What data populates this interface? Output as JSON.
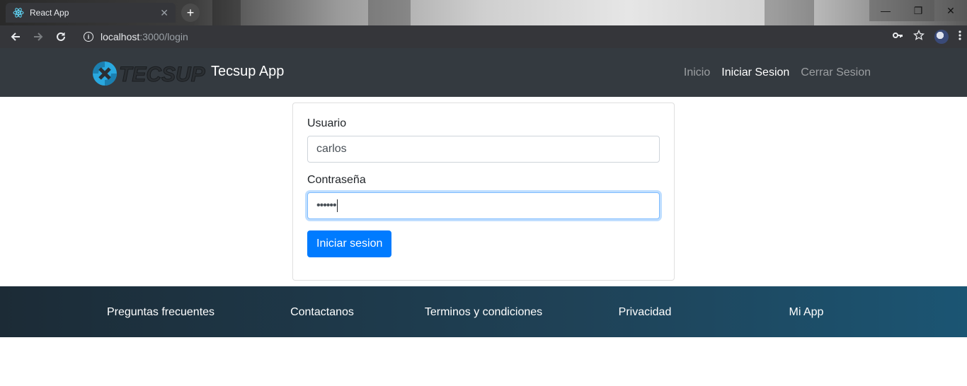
{
  "browser": {
    "tab_title": "React App",
    "tab_close": "✕",
    "new_tab": "+",
    "address_host": "localhost",
    "address_path": ":3000/login",
    "window_minimize": "—",
    "window_maximize": "❐",
    "window_close": "✕"
  },
  "navbar": {
    "logo_text": "TECSUP",
    "brand": "Tecsup App",
    "links": [
      {
        "label": "Inicio",
        "active": false
      },
      {
        "label": "Iniciar Sesion",
        "active": true
      },
      {
        "label": "Cerrar Sesion",
        "active": false
      }
    ]
  },
  "login": {
    "user_label": "Usuario",
    "user_value": "carlos",
    "password_label": "Contraseña",
    "password_value": "••••••",
    "submit_label": "Iniciar sesion"
  },
  "footer": {
    "links": [
      "Preguntas frecuentes",
      "Contactanos",
      "Terminos y condiciones",
      "Privacidad",
      "Mi App"
    ]
  },
  "colors": {
    "navbar_bg": "#343a40",
    "primary": "#007bff",
    "footer_start": "#1c2b36",
    "footer_end": "#1b5573",
    "logo_blue": "#29a8df"
  }
}
